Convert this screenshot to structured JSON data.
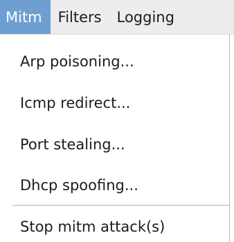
{
  "menubar": {
    "items": [
      {
        "label": "Mitm",
        "active": true
      },
      {
        "label": "Filters",
        "active": false
      },
      {
        "label": "Logging",
        "active": false
      }
    ]
  },
  "dropdown": {
    "items": [
      {
        "label": "Arp poisoning..."
      },
      {
        "label": "Icmp redirect..."
      },
      {
        "label": "Port stealing..."
      },
      {
        "label": "Dhcp spoofing..."
      },
      {
        "label": "Stop mitm attack(s)"
      }
    ]
  },
  "colors": {
    "menubar_bg": "#ededed",
    "active_bg": "#6f9fd0",
    "active_text": "#ffffff",
    "text": "#1c1c1c",
    "separator": "#d4d4d4"
  }
}
